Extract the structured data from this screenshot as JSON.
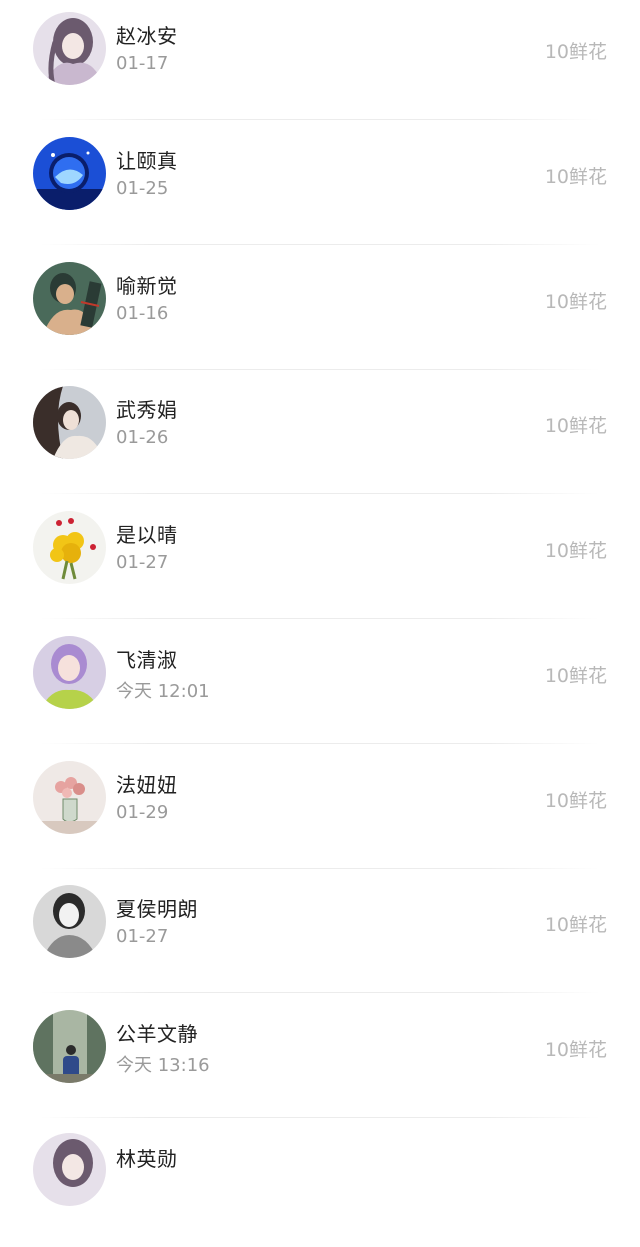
{
  "users": [
    {
      "name": "赵冰安",
      "date": "01-17",
      "gift": "10鲜花",
      "avatar": "avatar-girl-illustration-icon",
      "colors": {
        "bg": "#e6e0ea",
        "fg": "#6b5a6e",
        "accent": "#c9b8cf"
      }
    },
    {
      "name": "让颐真",
      "date": "01-25",
      "gift": "10鲜花",
      "avatar": "avatar-moon-whale-icon",
      "colors": {
        "bg": "#1b4fd6",
        "fg": "#0a1e6b",
        "accent": "#9fd7ff"
      }
    },
    {
      "name": "喻新觉",
      "date": "01-16",
      "gift": "10鲜花",
      "avatar": "avatar-couple-illustration-icon",
      "colors": {
        "bg": "#4a6a5a",
        "fg": "#d9b08c",
        "accent": "#2a3b35"
      }
    },
    {
      "name": "武秀娟",
      "date": "01-26",
      "gift": "10鲜花",
      "avatar": "avatar-woman-photo-icon",
      "colors": {
        "bg": "#c9cdd3",
        "fg": "#3a2e2a",
        "accent": "#efe8e2"
      }
    },
    {
      "name": "是以晴",
      "date": "01-27",
      "gift": "10鲜花",
      "avatar": "avatar-yellow-flowers-icon",
      "colors": {
        "bg": "#f3f3ef",
        "fg": "#f2c516",
        "accent": "#cc2233"
      }
    },
    {
      "name": "飞清淑",
      "date": "今天 12:01",
      "gift": "10鲜花",
      "avatar": "avatar-purple-hair-girl-icon",
      "colors": {
        "bg": "#d7cfe4",
        "fg": "#a98bd1",
        "accent": "#b6d24a"
      }
    },
    {
      "name": "法妞妞",
      "date": "01-29",
      "gift": "10鲜花",
      "avatar": "avatar-vase-flowers-icon",
      "colors": {
        "bg": "#efe9e6",
        "fg": "#e6a3a0",
        "accent": "#6f8b6a"
      }
    },
    {
      "name": "夏侯明朗",
      "date": "01-27",
      "gift": "10鲜花",
      "avatar": "avatar-bw-girl-photo-icon",
      "colors": {
        "bg": "#d8d8d8",
        "fg": "#2b2b2b",
        "accent": "#8a8a8a"
      }
    },
    {
      "name": "公羊文静",
      "date": "今天 13:16",
      "gift": "10鲜花",
      "avatar": "avatar-outdoor-person-photo-icon",
      "colors": {
        "bg": "#5f7360",
        "fg": "#2f4a8a",
        "accent": "#a9b6a3"
      }
    },
    {
      "name": "林英勋",
      "date": "",
      "gift": "",
      "avatar": "avatar-girl-illustration-icon",
      "colors": {
        "bg": "#e6e0ea",
        "fg": "#6b5a6e",
        "accent": "#c9b8cf"
      }
    }
  ]
}
